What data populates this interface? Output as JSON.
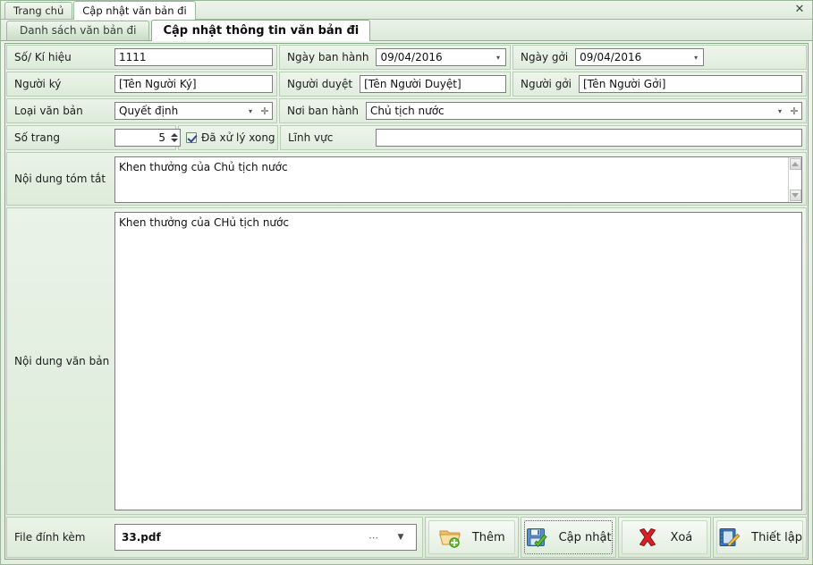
{
  "window": {
    "close_label": "✕"
  },
  "outer_tabs": [
    {
      "label": "Trang chủ",
      "active": false
    },
    {
      "label": "Cập nhật văn bản đi",
      "active": true
    }
  ],
  "inner_tabs": [
    {
      "label": "Danh sách văn bản đi",
      "active": false
    },
    {
      "label": "Cập nhật thông tin văn bản đi",
      "active": true
    }
  ],
  "form": {
    "so_ki_hieu": {
      "label": "Số/ Kí hiệu",
      "value": "1111"
    },
    "ngay_ban_hanh": {
      "label": "Ngày ban hành",
      "value": "09/04/2016"
    },
    "ngay_goi": {
      "label": "Ngày gởi",
      "value": "09/04/2016"
    },
    "nguoi_ky": {
      "label": "Người ký",
      "value": "[Tên Người Ký]"
    },
    "nguoi_duyet": {
      "label": "Người duyệt",
      "value": "[Tên Người Duyệt]"
    },
    "nguoi_goi": {
      "label": "Người gởi",
      "value": "[Tên Người Gởi]"
    },
    "loai_van_ban": {
      "label": "Loại văn bản",
      "value": "Quyết định"
    },
    "noi_ban_hanh": {
      "label": "Nơi ban hành",
      "value": "Chủ tịch nước"
    },
    "so_trang": {
      "label": "Số trang",
      "value": "5"
    },
    "da_xu_ly_xong": {
      "label": "Đã xử lý xong",
      "checked": true
    },
    "linh_vuc": {
      "label": "Lĩnh vực",
      "value": ""
    },
    "noi_dung_tom_tat": {
      "label": "Nội dung tóm tắt",
      "value": "Khen thưởng của Chủ tịch nước"
    },
    "noi_dung_van_ban": {
      "label": "Nội dung văn bản",
      "value": "Khen thưởng của CHủ tịch nước"
    },
    "file_dinh_kem": {
      "label": "File đính kèm",
      "value": "33.pdf",
      "browse_glyph": "⋯",
      "dropdown_glyph": "▼"
    }
  },
  "buttons": [
    {
      "label": "Thêm",
      "icon": "folder-add-icon",
      "focused": false
    },
    {
      "label": "Cập nhật",
      "icon": "save-check-icon",
      "focused": true
    },
    {
      "label": "Xoá",
      "icon": "delete-x-icon",
      "focused": false
    },
    {
      "label": "Thiết lập",
      "icon": "settings-notebook-icon",
      "focused": false
    }
  ],
  "glyphs": {
    "dropdown": "▾",
    "plus": "✛"
  },
  "colors": {
    "panel_bg": "#e6f0e4",
    "border": "#8aa98a",
    "field_border": "#7d7d7d",
    "accent_green": "#c9ddc5"
  }
}
